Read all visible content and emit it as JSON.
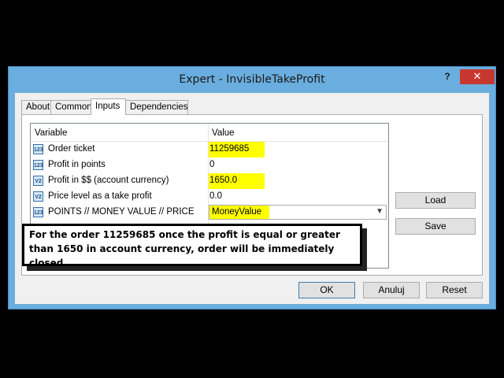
{
  "window": {
    "title": "Expert - InvisibleTakeProfit",
    "help_label": "?",
    "close_label": "✕"
  },
  "tabs": [
    {
      "label": "About",
      "active": false
    },
    {
      "label": "Common",
      "active": false
    },
    {
      "label": "Inputs",
      "active": true
    },
    {
      "label": "Dependencies",
      "active": false
    }
  ],
  "grid": {
    "columns": [
      "Variable",
      "Value"
    ],
    "rows": [
      {
        "icon": "123",
        "name": "Order ticket",
        "value": "11259685",
        "highlighted": true
      },
      {
        "icon": "123",
        "name": "Profit in points",
        "value": "0",
        "highlighted": false
      },
      {
        "icon": "V2",
        "name": "Profit in $$ (account currency)",
        "value": "1650.0",
        "highlighted": true
      },
      {
        "icon": "V2",
        "name": "Price level as a take profit",
        "value": "0.0",
        "highlighted": false
      },
      {
        "icon": "123",
        "name": "POINTS // MONEY VALUE // PRICE",
        "value": "MoneyValue",
        "highlighted": true,
        "dropdown": true
      }
    ]
  },
  "callout": {
    "text": "For the order 11259685 once the profit is equal or greater than 1650 in account currency, order will be immediately closed"
  },
  "buttons": {
    "load": "Load",
    "save": "Save",
    "ok": "OK",
    "cancel": "Anuluj",
    "reset": "Reset"
  },
  "colors": {
    "title_bar": "#6aaedf",
    "highlight": "#ffff00",
    "close": "#c7372f"
  }
}
